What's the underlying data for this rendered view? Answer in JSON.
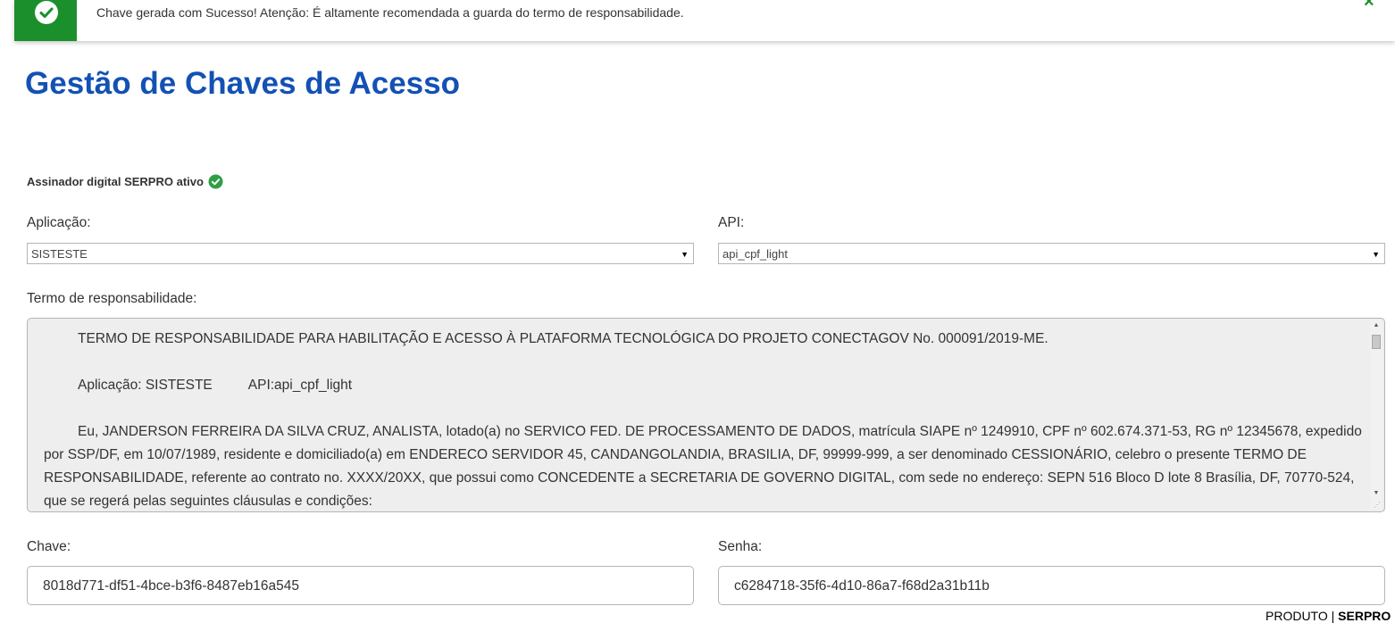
{
  "toast": {
    "message": "Chave gerada com Sucesso! Atenção: É altamente recomendada a guarda do termo de responsabilidade.",
    "close_label": "×",
    "color": "#1b8f2c"
  },
  "page": {
    "title": "Gestão de Chaves de Acesso",
    "title_color": "#1351b4"
  },
  "signer": {
    "status_text": "Assinador digital SERPRO ativo",
    "icon": "check-circle-icon"
  },
  "form": {
    "application": {
      "label": "Aplicação",
      "colon": ":",
      "selected": "SISTESTE"
    },
    "api": {
      "label": "API",
      "colon": ":",
      "selected": "api_cpf_light"
    },
    "terms": {
      "label": "Termo de responsabilidade",
      "colon": ":",
      "heading": "TERMO DE RESPONSABILIDADE PARA HABILITAÇÃO E ACESSO À PLATAFORMA TECNOLÓGICA DO PROJETO CONECTAGOV No. 000091/2019-ME.",
      "app_line": "Aplicação: SISTESTE",
      "api_line": "API:api_cpf_light",
      "body": "Eu, JANDERSON FERREIRA DA SILVA CRUZ, ANALISTA, lotado(a) no SERVICO FED. DE PROCESSAMENTO DE DADOS, matrícula SIAPE nº 1249910, CPF nº 602.674.371-53, RG nº 12345678, expedido por SSP/DF, em 10/07/1989, residente e domiciliado(a) em ENDERECO SERVIDOR 45, CANDANGOLANDIA, BRASILIA, DF, 99999-999, a ser denominado CESSIONÁRIO, celebro o presente TERMO DE RESPONSABILIDADE, referente ao contrato no. XXXX/20XX, que possui como CONCEDENTE a SECRETARIA DE GOVERNO DIGITAL, com sede no endereço: SEPN 516 Bloco D lote 8 Brasília, DF, 70770-524, que se regerá pelas seguintes cláusulas e condições:"
    },
    "key": {
      "label": "Chave",
      "colon": ":",
      "value": "8018d771-df51-4bce-b3f6-8487eb16a545"
    },
    "password": {
      "label": "Senha",
      "colon": ":",
      "value": "c6284718-35f6-4d10-86a7-f68d2a31b11b"
    }
  },
  "footer": {
    "product_label": "PRODUTO | ",
    "brand": "SERPRO"
  }
}
